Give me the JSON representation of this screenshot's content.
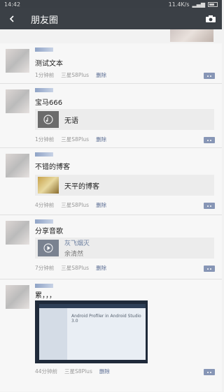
{
  "status": {
    "time": "14:42",
    "network": "11.4K/s"
  },
  "header": {
    "title": "朋友圈",
    "back_icon": "back-arrow-icon",
    "camera_icon": "camera-icon"
  },
  "posts": [
    {
      "text": "测试文本",
      "time": "1分钟前",
      "device": "三星S8Plus",
      "delete": "删除"
    },
    {
      "text": "宝马666",
      "share_title": "无语",
      "time": "1分钟前",
      "device": "三星S8Plus",
      "delete": "删除"
    },
    {
      "text": "不错的博客",
      "share_title": "天平的博客",
      "time": "4分钟前",
      "device": "三星S8Plus",
      "delete": "删除"
    },
    {
      "text": "分享音歌",
      "share_title": "灰飞烟灭",
      "share_subtitle": "余清然",
      "time": "7分钟前",
      "device": "三星S8Plus",
      "delete": "删除"
    },
    {
      "text": "累，，，",
      "photo_caption": "Android Profiler in Android Studio 3.0",
      "time": "44分钟前",
      "device": "三星S8Plus",
      "delete": "删除"
    }
  ],
  "colors": {
    "title_bar": "#3b4046",
    "link": "#5b6d93",
    "comment_button": "#8796b6"
  }
}
